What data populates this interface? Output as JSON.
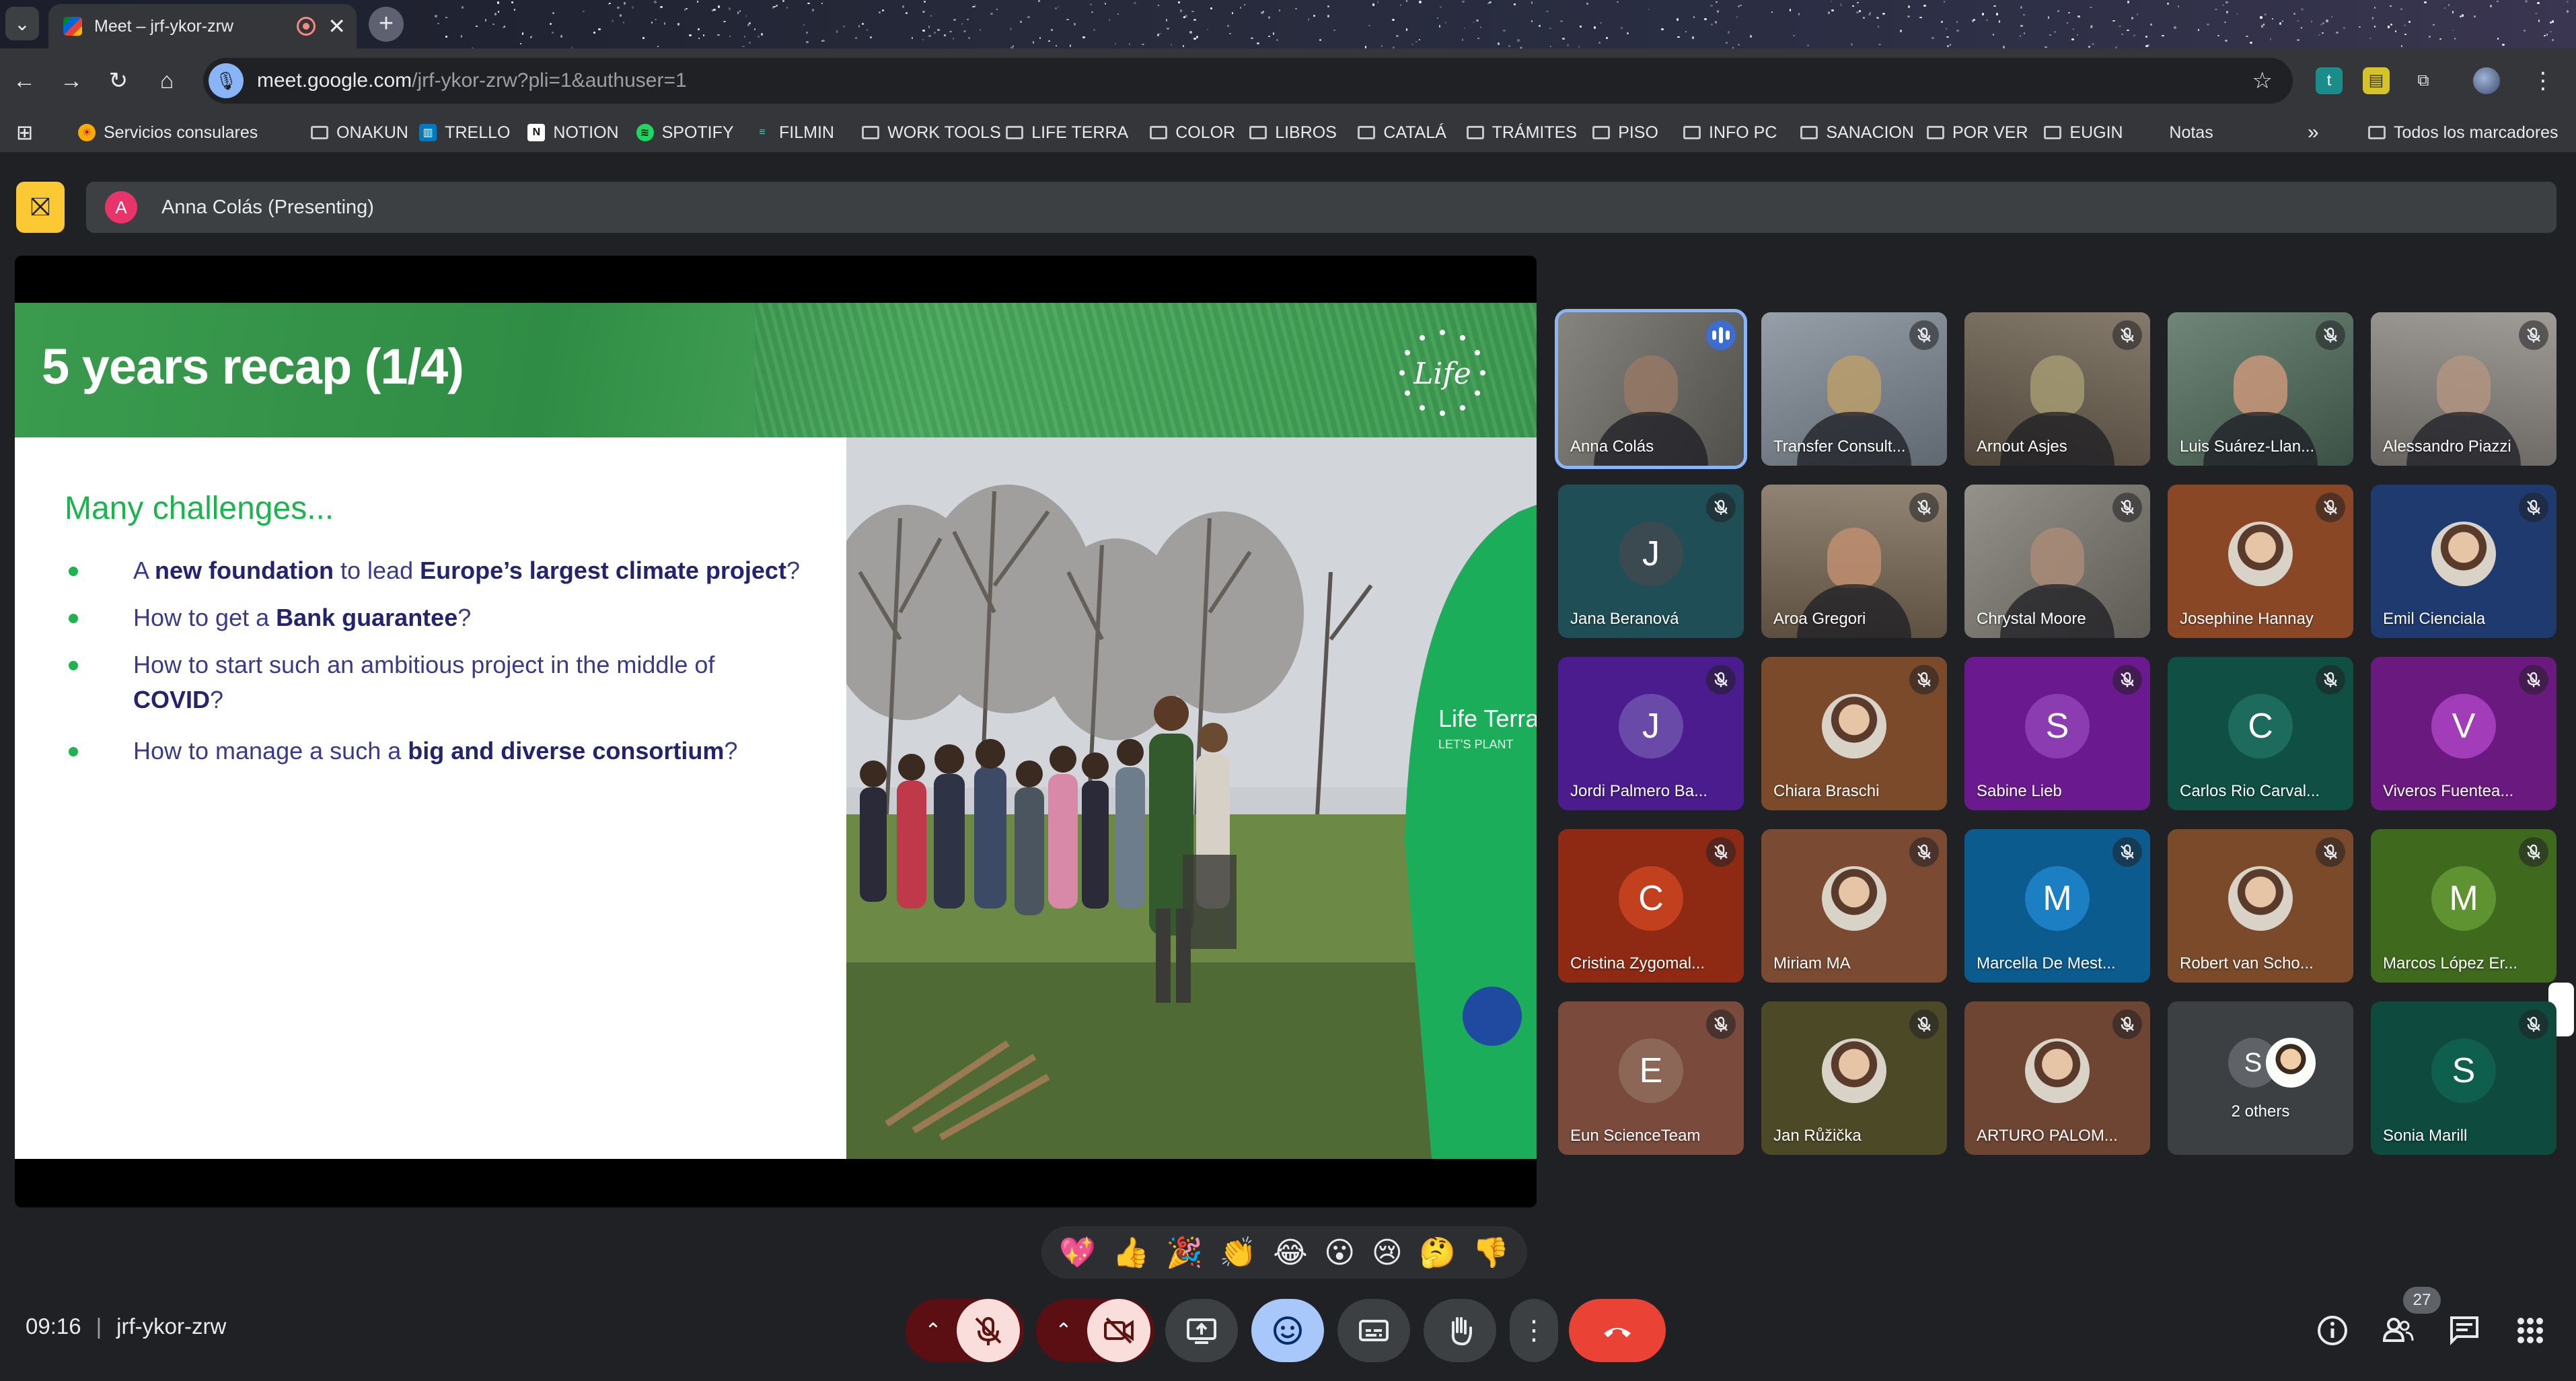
{
  "browser": {
    "tab_title": "Meet – jrf-ykor-zrw",
    "url_host": "meet.google.com",
    "url_path": "/jrf-ykor-zrw?pli=1&authuser=1",
    "bookmarks": [
      {
        "label": "Servicios consulares",
        "icon": "sun-icon"
      },
      {
        "label": "ONAKUN",
        "icon": "folder-icon"
      },
      {
        "label": "TRELLO",
        "icon": "trello-icon"
      },
      {
        "label": "NOTION",
        "icon": "notion-icon"
      },
      {
        "label": "SPOTIFY",
        "icon": "spotify-icon"
      },
      {
        "label": "FILMIN",
        "icon": "filmin-icon"
      },
      {
        "label": "WORK TOOLS",
        "icon": "folder-icon"
      },
      {
        "label": "LIFE TERRA",
        "icon": "folder-icon"
      },
      {
        "label": "COLOR",
        "icon": "folder-icon"
      },
      {
        "label": "LIBROS",
        "icon": "folder-icon"
      },
      {
        "label": "CATALÁ",
        "icon": "folder-icon"
      },
      {
        "label": "TRÁMITES",
        "icon": "folder-icon"
      },
      {
        "label": "PISO",
        "icon": "folder-icon"
      },
      {
        "label": "INFO PC",
        "icon": "folder-icon"
      },
      {
        "label": "SANACION",
        "icon": "folder-icon"
      },
      {
        "label": "POR VER",
        "icon": "folder-icon"
      },
      {
        "label": "EUGIN",
        "icon": "folder-icon"
      },
      {
        "label": "Notas",
        "icon": "apple-icon"
      }
    ],
    "all_bookmarks_label": "Todos los marcadores"
  },
  "meet": {
    "presenter_initial": "A",
    "presenter_label": "Anna Colás (Presenting)",
    "slide": {
      "title": "5 years recap (1/4)",
      "subtitle": "Many challenges...",
      "bullets": [
        {
          "parts": [
            "A ",
            "new foundation",
            " to lead ",
            "Europe’s largest climate project",
            "?"
          ]
        },
        {
          "parts": [
            "How to get a ",
            "Bank guarantee",
            "?"
          ]
        },
        {
          "parts": [
            "How to start such an ambitious project in the middle of ",
            "COVID",
            "?"
          ]
        },
        {
          "parts": [
            "How to manage a such a ",
            "big and diverse consortium",
            "?"
          ]
        }
      ],
      "logo_text": "Life",
      "banner_text": "Life Terra",
      "banner_sub": "LET'S PLANT"
    },
    "participants": [
      {
        "name": "Anna Colás",
        "kind": "video",
        "bg": "#6b6a63",
        "speaking": true
      },
      {
        "name": "Transfer Consult...",
        "kind": "video",
        "bg": "#7f8a96",
        "muted": true
      },
      {
        "name": "Arnout Asjes",
        "kind": "video",
        "bg": "#6a5d4c",
        "muted": true
      },
      {
        "name": "Luis Suárez-Llan...",
        "kind": "video",
        "bg": "#4f6c5c",
        "muted": true
      },
      {
        "name": "Alessandro Piazzi",
        "kind": "video",
        "bg": "#8a8580",
        "muted": true
      },
      {
        "name": "Jana Beranová",
        "kind": "initial",
        "initial": "J",
        "bg": "#1f4e56",
        "circle": "#3b4a50",
        "muted": true
      },
      {
        "name": "Aroa Gregori",
        "kind": "video",
        "bg": "#7b6a55",
        "muted": true
      },
      {
        "name": "Chrystal Moore",
        "kind": "video",
        "bg": "#7d7a70",
        "muted": true
      },
      {
        "name": "Josephine Hannay",
        "kind": "photo",
        "bg": "#8a4726",
        "muted": true
      },
      {
        "name": "Emil Cienciala",
        "kind": "photo",
        "bg": "#1e3a6e",
        "muted": true
      },
      {
        "name": "Jordi Palmero Ba...",
        "kind": "initial",
        "initial": "J",
        "bg": "#4a1c8e",
        "circle": "#6a4aa8",
        "muted": true
      },
      {
        "name": "Chiara Braschi",
        "kind": "photo",
        "bg": "#7a4a2a",
        "muted": true
      },
      {
        "name": "Sabine Lieb",
        "kind": "initial",
        "initial": "S",
        "bg": "#6a1a8e",
        "circle": "#8a3cb0",
        "muted": true
      },
      {
        "name": "Carlos Rio Carval...",
        "kind": "initial",
        "initial": "C",
        "bg": "#0f4f44",
        "circle": "#1d6b5c",
        "muted": true
      },
      {
        "name": "Viveros Fuentea...",
        "kind": "initial",
        "initial": "V",
        "bg": "#6a1a7e",
        "circle": "#a33cb8",
        "muted": true
      },
      {
        "name": "Cristina Zygomal...",
        "kind": "initial",
        "initial": "C",
        "bg": "#8e2a14",
        "circle": "#c2401e",
        "muted": true
      },
      {
        "name": "Miriam MA",
        "kind": "photo",
        "bg": "#7a4a32",
        "muted": true
      },
      {
        "name": "Marcella De Mest...",
        "kind": "initial",
        "initial": "M",
        "bg": "#0b5b8e",
        "circle": "#1c7fc4",
        "muted": true
      },
      {
        "name": "Robert van Scho...",
        "kind": "photo",
        "bg": "#7a4a2a",
        "muted": true
      },
      {
        "name": "Marcos López Er...",
        "kind": "initial",
        "initial": "M",
        "bg": "#3f6a1e",
        "circle": "#5f9230",
        "muted": true
      },
      {
        "name": "Eun ScienceTeam",
        "kind": "initial",
        "initial": "E",
        "bg": "#7a4a3c",
        "circle": "#8c6656",
        "muted": true
      },
      {
        "name": "Jan Růžička",
        "kind": "photo",
        "bg": "#4c4a26",
        "muted": true
      },
      {
        "name": "ARTURO PALOM...",
        "kind": "photo",
        "bg": "#6e4432",
        "muted": true
      },
      {
        "name": "2 others",
        "kind": "others",
        "initial": "S",
        "bg": "#3c4043"
      },
      {
        "name": "Sonia Marill",
        "kind": "initial",
        "initial": "S",
        "bg": "#0e4a3e",
        "circle": "#0f5f4e",
        "muted": true
      }
    ],
    "reactions": [
      "💖",
      "👍",
      "🎉",
      "👏",
      "😂",
      "😮",
      "😢",
      "🤔",
      "👎"
    ],
    "time": "09:16",
    "meeting_code": "jrf-ykor-zrw",
    "participant_count": "27",
    "colors": {
      "end_call": "#ea4335",
      "muted_red": "#f9dedc",
      "accent": "#8ab4f8"
    }
  }
}
